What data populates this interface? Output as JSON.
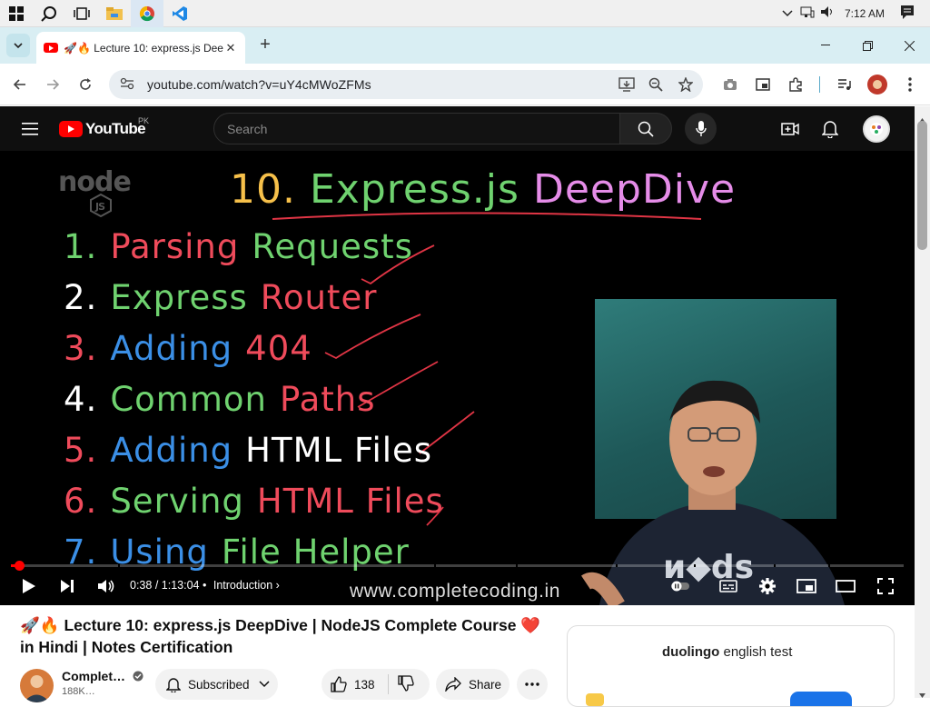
{
  "taskbar": {
    "clock": "7:12 AM"
  },
  "browser": {
    "tab_title": "🚀🔥 Lecture 10: express.js Dee",
    "url": "youtube.com/watch?v=uY4cMWoZFMs"
  },
  "youtube": {
    "logo_text": "YouTube",
    "country_code": "PK",
    "search_placeholder": "Search"
  },
  "video": {
    "slide_title_num": "10.",
    "slide_title_a": "Express.js",
    "slide_title_b": "DeepDive",
    "node_logo": "node",
    "slide_items": [
      {
        "num": "1.",
        "a": "Parsing",
        "b": "Requests",
        "ca": "#ef4b5b",
        "cb": "#6fd26f",
        "cn": "#6fd26f"
      },
      {
        "num": "2.",
        "a": "Express",
        "b": "Router",
        "ca": "#6fd26f",
        "cb": "#ef4b5b",
        "cn": "#ffffff"
      },
      {
        "num": "3.",
        "a": "Adding",
        "b": "404",
        "ca": "#3b8fe6",
        "cb": "#ef4b5b",
        "cn": "#ef4b5b"
      },
      {
        "num": "4.",
        "a": "Common",
        "b": "Paths",
        "ca": "#6fd26f",
        "cb": "#ef4b5b",
        "cn": "#ffffff"
      },
      {
        "num": "5.",
        "a": "Adding",
        "b": "HTML Files",
        "ca": "#3b8fe6",
        "cb": "#ffffff",
        "cn": "#ef4b5b"
      },
      {
        "num": "6.",
        "a": "Serving",
        "b": "HTML Files",
        "ca": "#6fd26f",
        "cb": "#ef4b5b",
        "cn": "#ef4b5b"
      },
      {
        "num": "7.",
        "a": "Using",
        "b": "File Helper",
        "ca": "#3b8fe6",
        "cb": "#6fd26f",
        "cn": "#3b8fe6"
      }
    ],
    "watermark": "www.completecoding.in",
    "time_current": "0:38",
    "time_total": "1:13:04",
    "chapter": "Introduction",
    "progress_fraction": 0.009
  },
  "below": {
    "title": "🚀🔥 Lecture 10: express.js DeepDive | NodeJS Complete Course ❤️ in Hindi | Notes Certification",
    "channel_name": "Complet…",
    "channel_subs": "188K…",
    "subscribed_label": "Subscribed",
    "like_count": "138",
    "share_label": "Share",
    "ad_brand": "duolingo",
    "ad_brand_suffix": "english test"
  },
  "colors": {
    "brand_red": "#ff0000",
    "tab_strip": "#d9eef3",
    "yt_bg": "#0f0f0f"
  }
}
